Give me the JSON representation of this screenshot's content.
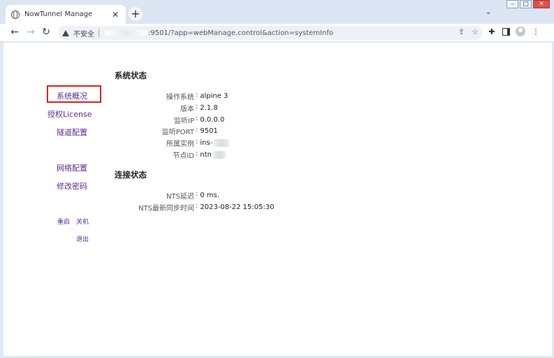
{
  "browser": {
    "tab_title": "NowTunnel Manage",
    "tab_close": "✕",
    "new_tab": "+",
    "security_label": "不安全",
    "url": ":9501/?app=webManage.control&action=systemInfo"
  },
  "sidebar": {
    "items": [
      {
        "label": "系统概况"
      },
      {
        "label": "授权License"
      },
      {
        "label": "隧道配置"
      },
      {
        "label": "网络配置"
      },
      {
        "label": "修改密码"
      },
      {
        "label": "重启"
      },
      {
        "label": "关机"
      },
      {
        "label": "退出"
      }
    ]
  },
  "system_status": {
    "title": "系统状态",
    "rows": [
      {
        "label": "操作系统",
        "value": "alpine 3"
      },
      {
        "label": "版本",
        "value": "2.1.8"
      },
      {
        "label": "监听IP",
        "value": "0.0.0.0"
      },
      {
        "label": "监听PORT",
        "value": "9501"
      },
      {
        "label": "所属实例",
        "value": "ins-"
      },
      {
        "label": "节点ID",
        "value": "ntn"
      }
    ]
  },
  "connection_status": {
    "title": "连接状态",
    "rows": [
      {
        "label": "NTS延迟",
        "value": "0 ms."
      },
      {
        "label": "NTS最新同步时间",
        "value": "2023-08-22 15:05:30"
      }
    ]
  },
  "colors": {
    "link": "#5b2c8f",
    "active_border": "#e02020"
  }
}
